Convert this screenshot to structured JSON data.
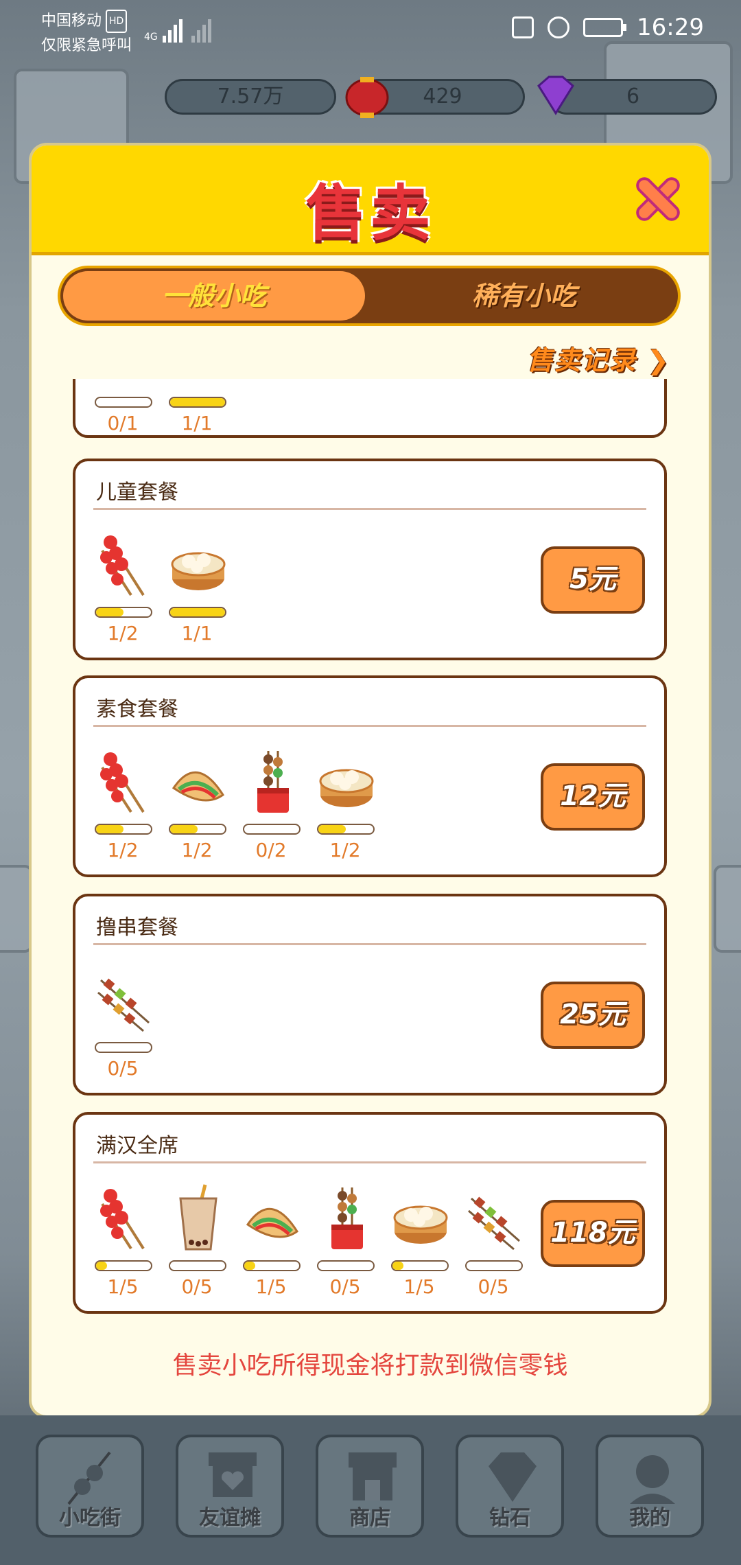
{
  "status_bar": {
    "carrier": "中国移动",
    "hd": "HD",
    "network": "4G",
    "emergency": "仅限紧急呼叫",
    "time": "16:29"
  },
  "resources": {
    "coins": "7.57万",
    "lanterns": "429",
    "gems": "6"
  },
  "modal": {
    "title": "售卖",
    "tabs": [
      {
        "label": "一般小吃",
        "active": true
      },
      {
        "label": "稀有小吃",
        "active": false
      }
    ],
    "history_link": "售卖记录",
    "footer_note": "售卖小吃所得现金将打款到微信零钱",
    "partial_card": {
      "items": [
        {
          "icon": "unknown-snack-icon",
          "count": "0/1",
          "progress": 0.0
        },
        {
          "icon": "unknown-snack-icon",
          "count": "1/1",
          "progress": 1.0
        }
      ]
    },
    "cards": [
      {
        "title": "儿童套餐",
        "price": "5元",
        "items": [
          {
            "icon": "tanghulu-icon",
            "count": "1/2",
            "progress": 0.5
          },
          {
            "icon": "steamed-bun-icon",
            "count": "1/1",
            "progress": 1.0
          }
        ]
      },
      {
        "title": "素食套餐",
        "price": "12元",
        "items": [
          {
            "icon": "tanghulu-icon",
            "count": "1/2",
            "progress": 0.5
          },
          {
            "icon": "pancake-icon",
            "count": "1/2",
            "progress": 0.5
          },
          {
            "icon": "mushroom-skewer-cup-icon",
            "count": "0/2",
            "progress": 0.0
          },
          {
            "icon": "steamed-bun-icon",
            "count": "1/2",
            "progress": 0.5
          }
        ]
      },
      {
        "title": "撸串套餐",
        "price": "25元",
        "items": [
          {
            "icon": "meat-skewer-icon",
            "count": "0/5",
            "progress": 0.0
          }
        ]
      },
      {
        "title": "满汉全席",
        "price": "118元",
        "items": [
          {
            "icon": "tanghulu-icon",
            "count": "1/5",
            "progress": 0.2
          },
          {
            "icon": "bubble-tea-icon",
            "count": "0/5",
            "progress": 0.0
          },
          {
            "icon": "pancake-icon",
            "count": "1/5",
            "progress": 0.2
          },
          {
            "icon": "mushroom-skewer-cup-icon",
            "count": "0/5",
            "progress": 0.0
          },
          {
            "icon": "steamed-bun-icon",
            "count": "1/5",
            "progress": 0.2
          },
          {
            "icon": "meat-skewer-icon",
            "count": "0/5",
            "progress": 0.0
          }
        ]
      }
    ]
  },
  "bottom_nav": [
    {
      "label": "小吃街",
      "icon": "sausage-skewer-icon"
    },
    {
      "label": "友谊摊",
      "icon": "heart-stall-icon"
    },
    {
      "label": "商店",
      "icon": "shop-icon"
    },
    {
      "label": "钻石",
      "icon": "diamond-icon"
    },
    {
      "label": "我的",
      "icon": "avatar-icon"
    }
  ],
  "colors": {
    "header_yellow": "#ffd800",
    "accent_orange": "#ff9a44",
    "dark_brown": "#7a3e12",
    "progress_yellow": "#f8d315",
    "title_red": "#e8343a",
    "note_red": "#e4463e"
  }
}
